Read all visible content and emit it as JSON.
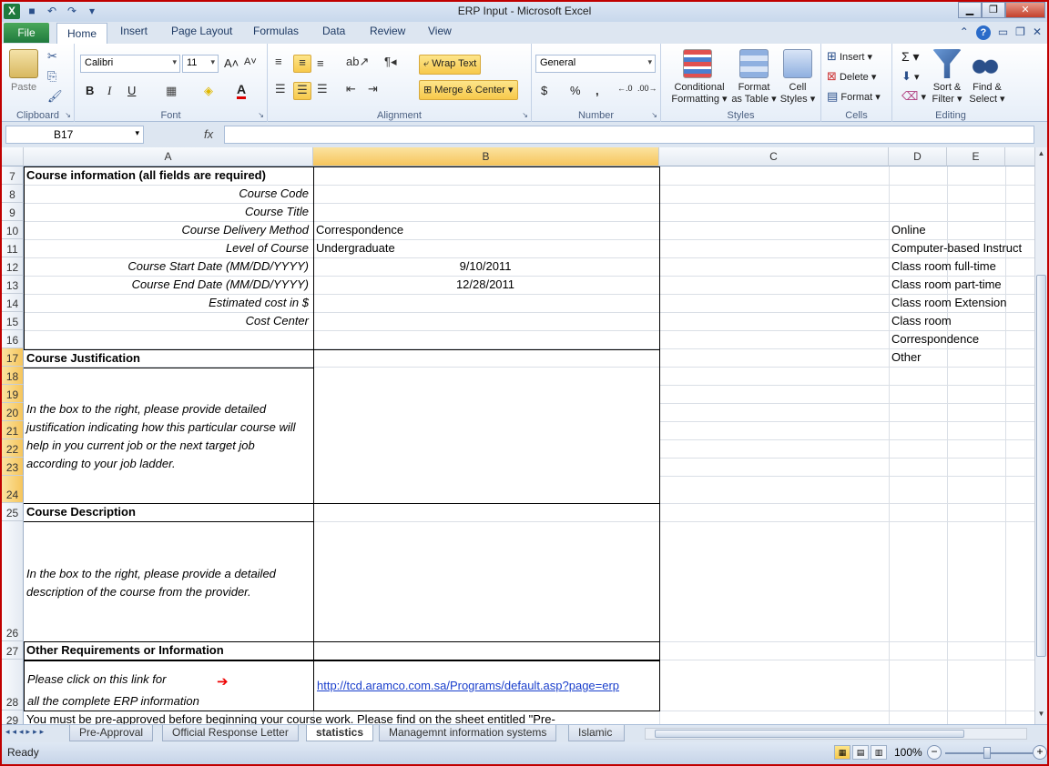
{
  "window": {
    "title": "ERP Input  -  Microsoft Excel"
  },
  "ribbon_tabs": [
    "File",
    "Home",
    "Insert",
    "Page Layout",
    "Formulas",
    "Data",
    "Review",
    "View"
  ],
  "ribbon": {
    "clipboard": {
      "paste": "Paste",
      "label": "Clipboard"
    },
    "font": {
      "name": "Calibri",
      "size": "11",
      "bold": "B",
      "italic": "I",
      "underline": "U",
      "label": "Font"
    },
    "alignment": {
      "wrap_text": "Wrap Text",
      "merge_center": "Merge & Center",
      "label": "Alignment"
    },
    "number": {
      "format": "General",
      "currency": "$",
      "percent": "%",
      "comma": ",",
      "inc_dec": ".0←.00",
      "dec_dec": ".00→.0",
      "label": "Number"
    },
    "styles": {
      "cond1": "Conditional",
      "cond2": "Formatting",
      "fmt1": "Format",
      "fmt2": "as Table",
      "cell1": "Cell",
      "cell2": "Styles",
      "label": "Styles"
    },
    "cells": {
      "insert": "Insert",
      "delete": "Delete",
      "format": "Format",
      "label": "Cells"
    },
    "editing": {
      "sigma": "Σ",
      "sort1": "Sort &",
      "sort2": "Filter",
      "find1": "Find &",
      "find2": "Select",
      "label": "Editing"
    }
  },
  "formula_bar": {
    "name_box": "B17",
    "fx": "fx",
    "formula": ""
  },
  "columns": [
    "A",
    "B",
    "C",
    "D",
    "E"
  ],
  "rows": [
    "7",
    "8",
    "9",
    "10",
    "11",
    "12",
    "13",
    "14",
    "15",
    "16",
    "17",
    "18",
    "19",
    "20",
    "21",
    "22",
    "23",
    "24",
    "25",
    "26",
    "27",
    "28",
    "29"
  ],
  "sheet": {
    "a7": "Course information (all fields are required)",
    "a8": "Course Code",
    "a9": "Course Title",
    "a10": "Course Delivery Method",
    "a11": "Level of Course",
    "a12": "Course Start Date (MM/DD/YYYY)",
    "a13": "Course End Date (MM/DD/YYYY)",
    "a14": "Estimated cost in $",
    "a15": "Cost Center",
    "b10": "Correspondence",
    "b11": "Undergraduate",
    "b12": "9/10/2011",
    "b13": "12/28/2011",
    "a17": "Course Justification",
    "justification_text": "In the box to the right, please provide detailed justification indicating how this particular course will help in you current job or the next target job according to your job ladder.",
    "a25": "Course Description",
    "description_text": "In the box to the right, please provide a detailed description of the course from the provider.",
    "a27": "Other Requirements or Information",
    "link_line1": "Please click on this link for",
    "link_line2": "all the complete ERP information",
    "link_url": "http://tcd.aramco.com.sa/Programs/default.asp?page=erp",
    "a29": "You must be pre-approved before beginning your course work.  Please find on the sheet entitled \"Pre-",
    "d_list": [
      "Online",
      "Computer-based Instruct",
      "Class room full-time",
      "Class room part-time",
      "Class room Extension",
      "Class room",
      "Correspondence",
      "Other"
    ]
  },
  "sheet_tabs": [
    "Pre-Approval",
    "Official Response Letter",
    "statistics",
    "Managemnt information systems",
    "Islamic"
  ],
  "active_sheet": "statistics",
  "status": {
    "text": "Ready",
    "zoom": "100%"
  }
}
